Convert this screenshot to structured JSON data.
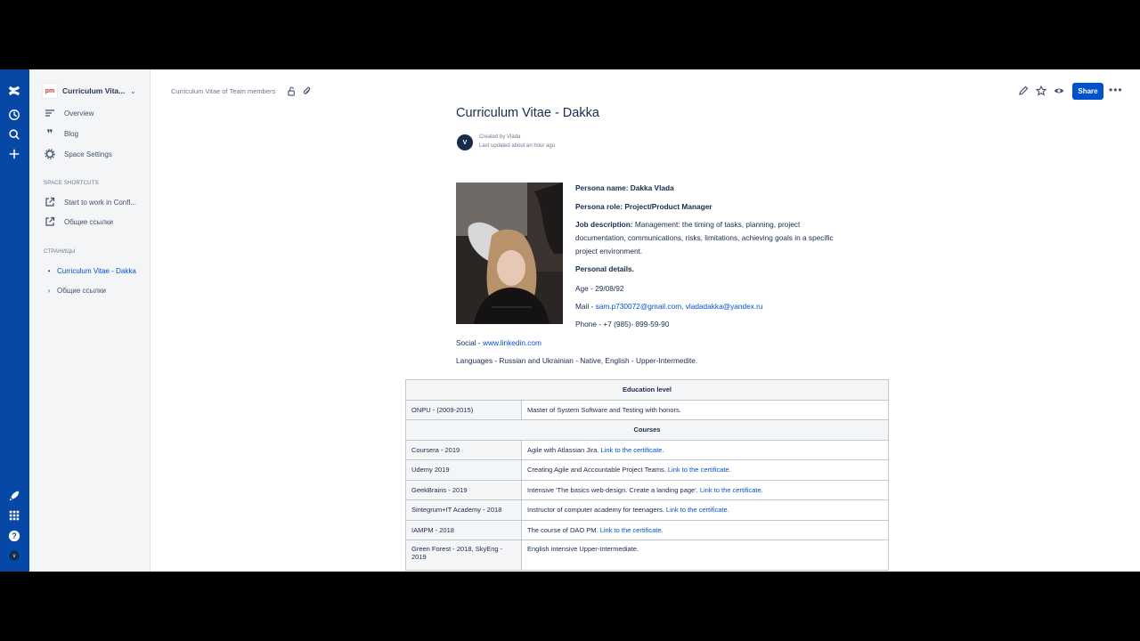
{
  "sidebar": {
    "space_name": "Curriculum Vita...",
    "space_logo_text": "pm",
    "nav": [
      {
        "label": "Overview",
        "icon": "overview-icon"
      },
      {
        "label": "Blog",
        "icon": "quote-icon"
      },
      {
        "label": "Space Settings",
        "icon": "gear-icon"
      }
    ],
    "shortcuts_title": "SPACE SHORTCUTS",
    "shortcuts": [
      {
        "label": "Start to work in Confl...",
        "icon": "external-link-icon"
      },
      {
        "label": "Общие ссылки",
        "icon": "external-link-icon"
      }
    ],
    "pages_title": "СТРАНИЦЫ",
    "pages": [
      {
        "label": "Curriculum Vitae - Dakka",
        "active": true
      },
      {
        "label": "Общие ссылки",
        "active": false
      }
    ]
  },
  "header": {
    "breadcrumb": "Curriculum Vitae of Team members",
    "share_label": "Share"
  },
  "page": {
    "title": "Curriculum Vitae - Dakka",
    "avatar_initial": "V",
    "created_by": "Created by Vlada",
    "last_updated": "Last updated about an hour ago",
    "persona_name": "Persona name: Dakka Vlada",
    "persona_role": "Persona role: Project/Product Manager",
    "job_label": "Job description:",
    "job_text": "Management: the timing of tasks, planning, project documentation, communications, risks, limitations, achieving goals in a specific project environment.",
    "personal_details": "Personal details.",
    "age": "Age - 29/08/92",
    "mail_label": "Mail - ",
    "mail_values": "sam.p730072@gmail.com, vladadakka@yandex.ru",
    "phone": "Phone - +7 (985)- 899-59-90",
    "social_label": "Social - ",
    "social_link": "www.linkedin.com",
    "languages": "Languages - Russian and Ukrainian  - Native,  English - Upper-Intermedite."
  },
  "table": {
    "education_header": "Education level",
    "education": [
      {
        "left": "ONPU  - (2009-2015)",
        "right": "Master of System Software and Testing with honors.",
        "link": ""
      }
    ],
    "courses_header": "Courses",
    "courses": [
      {
        "left": "Coursera - 2019",
        "right": "Agile with Atlassian Jira. ",
        "link": "Link to the certificate."
      },
      {
        "left": "Udemy 2019",
        "right": "Creating Agile and Accountable Project Teams. ",
        "link": "Link to the certificate."
      },
      {
        "left": "GeekBrains - 2019",
        "right": "Intensive 'The basics web-design. Create a landing page'. ",
        "link": "Link to the certificate."
      },
      {
        "left": "Sintegrum+IT Academy - 2018",
        "right": "Instructor of computer academy for teenagers.  ",
        "link": "Link to the certificate."
      },
      {
        "left": " IAMPM - 2018",
        "right": "The course of DAO PM. ",
        "link": "Link to the certificate."
      },
      {
        "left": " Green Forest - 2018, SkyEng - 2019",
        "right": "English intensive Upper-Intermediate.",
        "link": ""
      }
    ]
  },
  "colors": {
    "rail": "#0747a6",
    "link": "#0052cc",
    "share": "#0052cc"
  }
}
